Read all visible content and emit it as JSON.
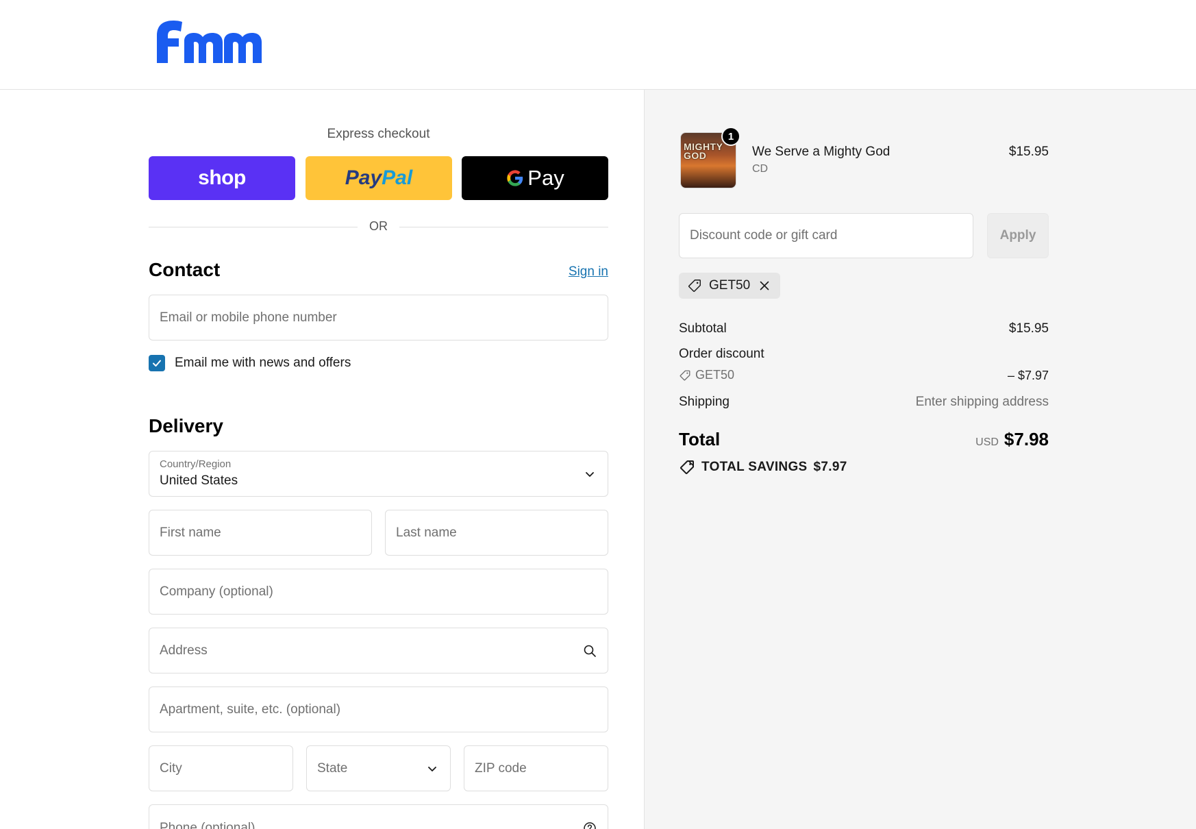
{
  "brand": {
    "logo_text": "fmm",
    "logo_color": "#1a5cf0"
  },
  "express": {
    "title": "Express checkout",
    "shop_label": "shop",
    "paypal_part1": "Pay",
    "paypal_part2": "Pal",
    "gpay_label": "Pay",
    "or_label": "OR"
  },
  "contact": {
    "title": "Contact",
    "signin_label": "Sign in",
    "email_placeholder": "Email or mobile phone number",
    "newsletter_label": "Email me with news and offers",
    "newsletter_checked": true
  },
  "delivery": {
    "title": "Delivery",
    "country_label": "Country/Region",
    "country_value": "United States",
    "first_name_placeholder": "First name",
    "last_name_placeholder": "Last name",
    "company_placeholder": "Company (optional)",
    "address_placeholder": "Address",
    "apartment_placeholder": "Apartment, suite, etc. (optional)",
    "city_placeholder": "City",
    "state_placeholder": "State",
    "zip_placeholder": "ZIP code",
    "phone_placeholder": "Phone (optional)"
  },
  "order": {
    "item": {
      "name": "We Serve a Mighty God",
      "variant": "CD",
      "price": "$15.95",
      "quantity": "1",
      "thumb_text": "MIGHTY GOD"
    },
    "discount_placeholder": "Discount code or gift card",
    "apply_label": "Apply",
    "applied_code": "GET50",
    "subtotal_label": "Subtotal",
    "subtotal_value": "$15.95",
    "order_discount_label": "Order discount",
    "discount_code": "GET50",
    "discount_value": "– $7.97",
    "shipping_label": "Shipping",
    "shipping_value": "Enter shipping address",
    "total_label": "Total",
    "total_currency": "USD",
    "total_value": "$7.98",
    "savings_label": "TOTAL SAVINGS",
    "savings_value": "$7.97"
  },
  "colors": {
    "accent": "#1773b0",
    "shop_purple": "#5a31f4",
    "paypal_yellow": "#ffc439",
    "gpay_black": "#000000"
  }
}
